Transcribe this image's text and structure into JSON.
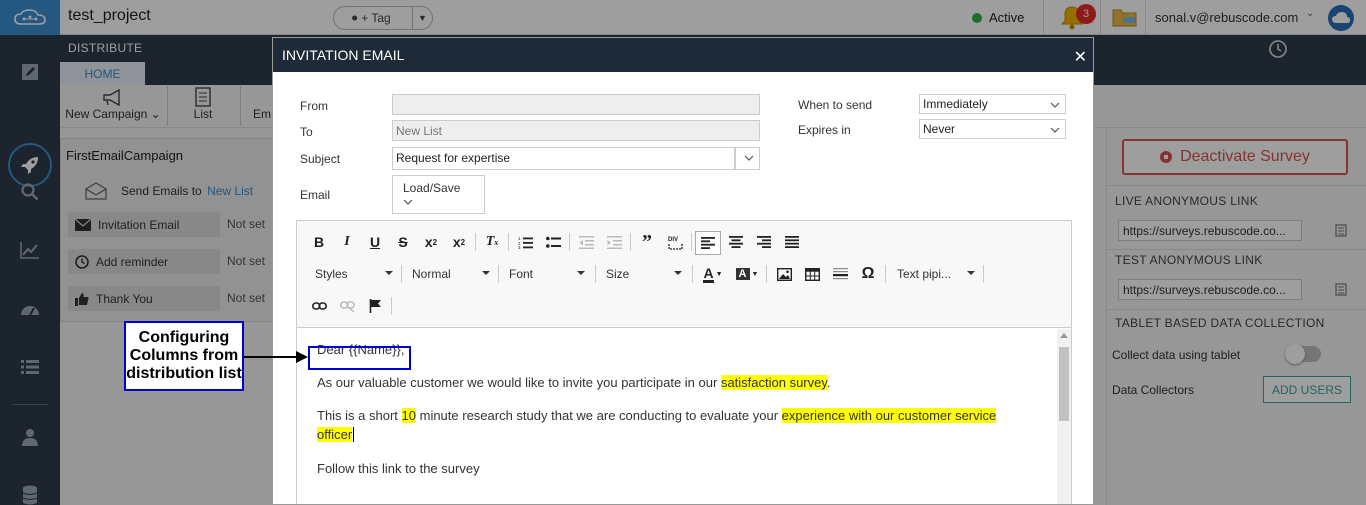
{
  "app": {
    "project_title": "test_project",
    "tag_label": "+ Tag",
    "status_label": "Active",
    "notification_count": "3",
    "user_email": "sonal.v@rebuscode.com"
  },
  "distribute": {
    "header_label": "DISTRIBUTE",
    "home_tab": "HOME",
    "ribbon": {
      "new_campaign": "New Campaign",
      "list": "List",
      "em": "Em"
    }
  },
  "campaign": {
    "title": "FirstEmailCampaign",
    "send_label": "Send Emails to",
    "send_link": "New List",
    "steps": [
      {
        "label": "Invitation Email",
        "value": "Not set"
      },
      {
        "label": "Add reminder",
        "value": "Not set"
      },
      {
        "label": "Thank You",
        "value": "Not set"
      }
    ]
  },
  "right_panel": {
    "deactivate_label": "Deactivate Survey",
    "live_link_title": "LIVE ANONYMOUS LINK",
    "live_link_value": "https://surveys.rebuscode.co...",
    "test_link_title": "TEST ANONYMOUS LINK",
    "test_link_value": "https://surveys.rebuscode.co...",
    "tablet_title": "TABLET BASED DATA COLLECTION",
    "collect_label": "Collect data using tablet",
    "collectors_label": "Data Collectors",
    "add_users_label": "ADD USERS"
  },
  "modal": {
    "title": "INVITATION EMAIL",
    "from_label": "From",
    "from_value": "",
    "to_label": "To",
    "to_value": "New List",
    "subject_label": "Subject",
    "subject_value": "Request for expertise",
    "email_label": "Email",
    "load_save_label": "Load/Save",
    "when_label": "When to send",
    "when_value": "Immediately",
    "expires_label": "Expires in",
    "expires_value": "Never",
    "toolbar": {
      "styles": "Styles",
      "format": "Normal",
      "font": "Font",
      "size": "Size",
      "text_piping": "Text pipi..."
    },
    "body": {
      "line1": "Dear {{Name}},",
      "line2_a": "As our valuable customer we would like to invite you participate in our ",
      "line2_hl": "satisfaction survey",
      "line2_b": ".",
      "line3_a": "This is a short ",
      "line3_hl1": "10",
      "line3_b": " minute research study that we are conducting to evaluate your ",
      "line3_hl2": "experience with our customer service",
      "line3_hl3": "officer",
      "line4": "Follow this link to the survey"
    }
  },
  "annotation": {
    "line1": "Configuring",
    "line2": "Columns from",
    "line3": "distribution list"
  },
  "colors": {
    "accent": "#3a8fd0",
    "sidebar": "#2e3b4a",
    "modal_header": "#1e2a37",
    "danger": "#d9534f",
    "highlight": "#ffff00",
    "annotation_border": "#0000cc"
  }
}
